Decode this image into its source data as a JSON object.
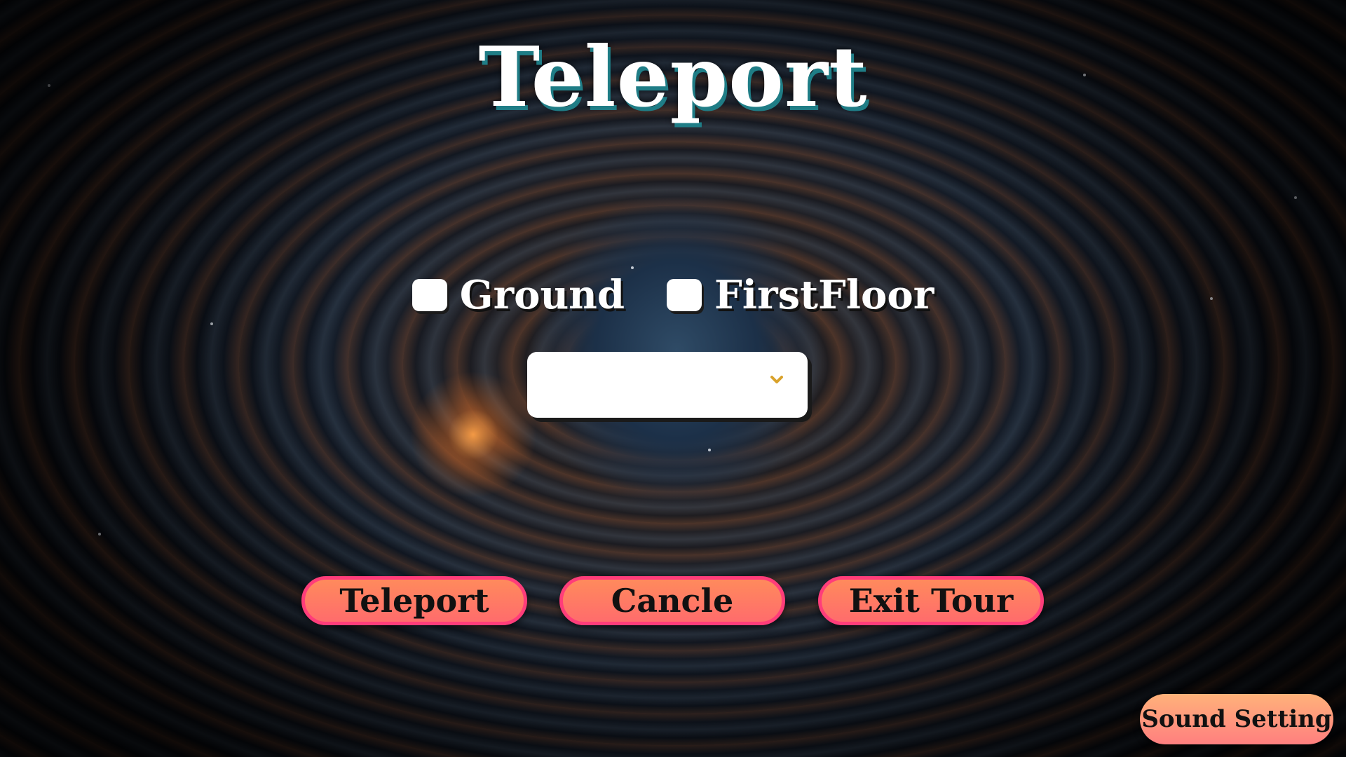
{
  "title": "Teleport",
  "floor_options": [
    {
      "label": "Ground",
      "checked": false
    },
    {
      "label": "FirstFloor",
      "checked": false
    }
  ],
  "location_select": {
    "value": "",
    "icon": "chevron-down-icon",
    "icon_color": "#d9a22b"
  },
  "buttons": {
    "teleport": "Teleport",
    "cancel": "Cancle",
    "exit_tour": "Exit Tour"
  },
  "sound_setting": "Sound Setting",
  "colors": {
    "title_shadow": "#1f7d86",
    "button_fill": "#ff7a63",
    "button_border": "#ff3d7a"
  }
}
